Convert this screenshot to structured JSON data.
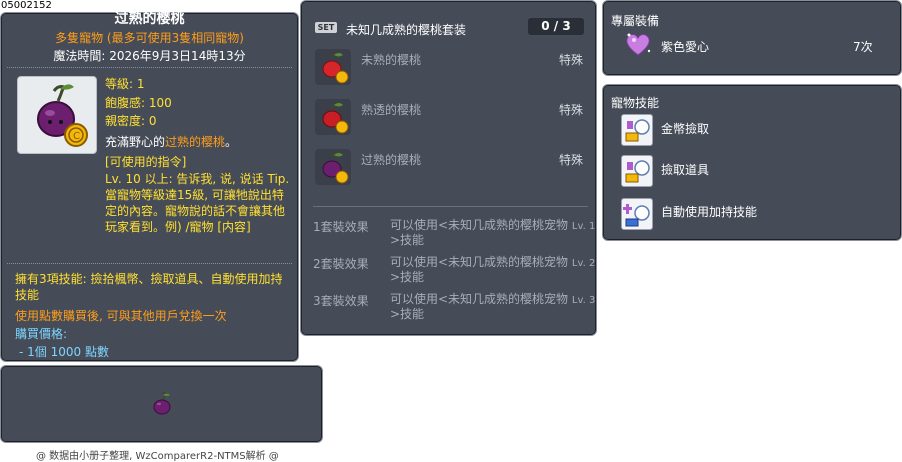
{
  "item_id": "05002152",
  "main": {
    "title": "过熟的樱桃",
    "subtitle": "多隻寵物 (最多可使用3隻相同寵物)",
    "expiry": "魔法時間: 2026年9月3日14時13分",
    "stats": {
      "level": "等級: 1",
      "fullness": "飽腹感: 100",
      "closeness": "親密度: 0"
    },
    "desc_prefix": "充滿野心的",
    "desc_highlight": "过熟的樱桃",
    "desc_suffix": "。",
    "commands_title": "[可使用的指令]",
    "commands_body": "Lv. 10 以上: 告诉我, 说, 说话 Tip. 當寵物等級達15級, 可讓牠說出特定的內容。寵物說的話不會讓其他玩家看到。例) /寵物 [内容]",
    "skills_note": "擁有3項技能: 撿拾楓幣、撿取道具、自動使用加持技能",
    "trade_note": "使用點數購買後, 可與其他用戶兌換一次",
    "price_label": "購買價格:",
    "price": "- 1個 1000 點數"
  },
  "set": {
    "badge": "SET",
    "name": "未知几成熟的樱桃套装",
    "count": "0 / 3",
    "items": [
      {
        "name": "未熟的樱桃",
        "type": "特殊",
        "icon": "red-cherry-icon"
      },
      {
        "name": "熟透的樱桃",
        "type": "特殊",
        "icon": "red-cherry-icon"
      },
      {
        "name": "过熟的樱桃",
        "type": "特殊",
        "icon": "purple-cherry-icon"
      }
    ],
    "effects": [
      {
        "label": "1套裝效果",
        "desc": "可以使用<未知几成熟的樱桃宠物",
        "lv": "Lv. 1",
        "desc2": ">技能"
      },
      {
        "label": "2套裝效果",
        "desc": "可以使用<未知几成熟的樱桃宠物",
        "lv": "Lv. 2",
        "desc2": ">技能"
      },
      {
        "label": "3套裝效果",
        "desc": "可以使用<未知几成熟的樱桃宠物",
        "lv": "Lv. 3",
        "desc2": ">技能"
      }
    ]
  },
  "exclusive": {
    "title": "專屬裝備",
    "item": "紫色愛心",
    "qty": "7次"
  },
  "pet_skills": {
    "title": "寵物技能",
    "items": [
      "金幣撿取",
      "撿取道具",
      "自動使用加持技能"
    ]
  },
  "footer": "@ 数据由小册子整理, WzComparerR2-NTMS解析 @",
  "colors": {
    "panel_bg": "#454b57",
    "gold": "#ffe033",
    "orange": "#ff9e1b",
    "blue": "#7fd5ff",
    "purple_cherry": "#6b1f6e"
  }
}
